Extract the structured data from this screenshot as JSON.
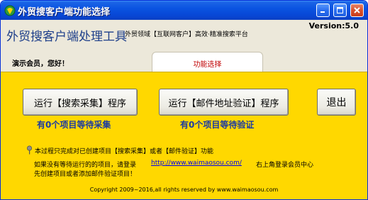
{
  "window": {
    "title": "外贸搜客户端功能选择",
    "minimize_icon": "minimize-icon",
    "maximize_icon": "maximize-icon",
    "close_icon": "close-icon"
  },
  "header": {
    "app_name": "外贸搜客户端处理工具",
    "subtitle": "外贸领域【互联网客户】高效·精准搜索平台",
    "version": "Version:5.0",
    "welcome": "演示会员，您好！",
    "active_tab": "功能选择"
  },
  "actions": {
    "search_button": "运行【搜索采集】程序",
    "verify_button": "运行【邮件地址验证】程序",
    "quit_button": "退出",
    "search_pending": "有0个项目等待采集",
    "verify_pending": "有0个项目等待验证"
  },
  "info": {
    "note": "本过程只完成对已创建项目【搜索采集】或者【邮件验证】功能",
    "hint_line1": "如果没有等待运行的的项目，请登录",
    "link": "http://www.waimaosou.com/",
    "hint_right": "右上角登录会员中心",
    "hint_line2": "先创建项目或者添加邮件验证项目！",
    "copyright": "Copyright 2009~2016,all rights reserved by www.waimaosou.com"
  },
  "colors": {
    "panel": "#ffd800",
    "titlebar": "#0a54e1",
    "pending_text": "#1a3aa3",
    "tab_text": "#c00000"
  }
}
